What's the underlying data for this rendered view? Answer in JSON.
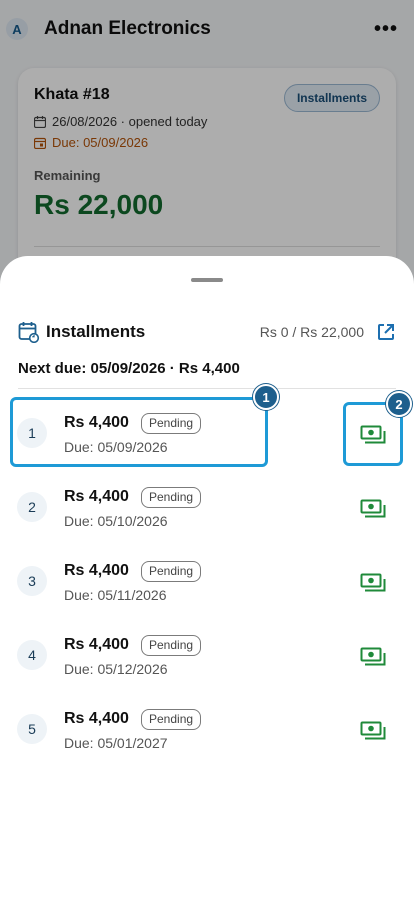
{
  "header": {
    "avatar_letter": "A",
    "title": "Adnan Electronics",
    "more_label": "•••"
  },
  "khata": {
    "title": "Khata #18",
    "type_label": "Installments",
    "opened_text": "26/08/2026 · opened today",
    "due_text": "Due: 05/09/2026",
    "remaining_label": "Remaining",
    "remaining_value": "Rs 22,000"
  },
  "sheet": {
    "title": "Installments",
    "progress": "Rs 0 / Rs 22,000",
    "next_due": "Next due: 05/09/2026 · Rs 4,400",
    "installments": [
      {
        "number": "1",
        "amount": "Rs 4,400",
        "status": "Pending",
        "due": "Due: 05/09/2026"
      },
      {
        "number": "2",
        "amount": "Rs 4,400",
        "status": "Pending",
        "due": "Due: 05/10/2026"
      },
      {
        "number": "3",
        "amount": "Rs 4,400",
        "status": "Pending",
        "due": "Due: 05/11/2026"
      },
      {
        "number": "4",
        "amount": "Rs 4,400",
        "status": "Pending",
        "due": "Due: 05/12/2026"
      },
      {
        "number": "5",
        "amount": "Rs 4,400",
        "status": "Pending",
        "due": "Due: 05/01/2027"
      }
    ]
  },
  "annotations": [
    "1",
    "2"
  ],
  "colors": {
    "accent": "#1e9ad6",
    "remaining_green": "#136b2e",
    "pay_green": "#1f8a3a",
    "due_orange": "#b4530a"
  },
  "icons": {
    "more": "more-horizontal-icon",
    "calendar": "calendar-icon",
    "calendar_due": "calendar-due-icon",
    "installments": "calendar-refresh-icon",
    "open": "open-in-new-icon",
    "pay": "payments-icon"
  }
}
